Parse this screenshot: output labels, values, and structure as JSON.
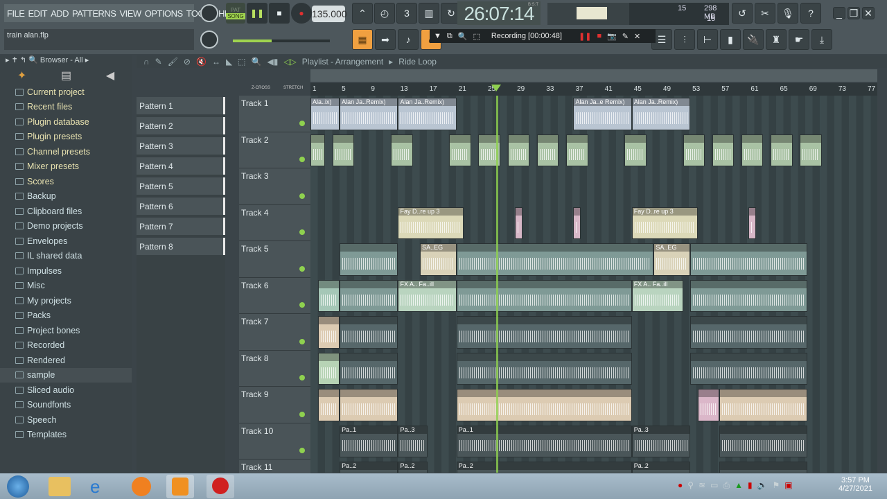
{
  "menu": [
    "FILE",
    "EDIT",
    "ADD",
    "PATTERNS",
    "VIEW",
    "OPTIONS",
    "TOOLS",
    "HELP"
  ],
  "file_name": "train alan.flp",
  "transport": {
    "pat": "PAT",
    "song": "SONG",
    "tempo": "135.000",
    "time": "26:07:14",
    "time_sig": "B:S:T"
  },
  "meters": {
    "cpu": "15",
    "memory": "298 MB",
    "polyphony": "15"
  },
  "recording": {
    "label": "Recording [00:00:48]"
  },
  "browser": {
    "title": "Browser - All",
    "items": [
      "Current project",
      "Recent files",
      "Plugin database",
      "Plugin presets",
      "Channel presets",
      "Mixer presets",
      "Scores",
      "Backup",
      "Clipboard files",
      "Demo projects",
      "Envelopes",
      "IL shared data",
      "Impulses",
      "Misc",
      "My projects",
      "Packs",
      "Project bones",
      "Recorded",
      "Rendered",
      "sample",
      "Sliced audio",
      "Soundfonts",
      "Speech",
      "Templates"
    ],
    "selected": "sample"
  },
  "patterns": [
    "Pattern 1",
    "Pattern 2",
    "Pattern 3",
    "Pattern 4",
    "Pattern 5",
    "Pattern 6",
    "Pattern 7",
    "Pattern 8"
  ],
  "playlist": {
    "title": "Playlist - Arrangement",
    "pattern": "Ride Loop",
    "zcross": "Z-CROSS",
    "stretch": "STRETCH",
    "bars": [
      "1",
      "5",
      "9",
      "13",
      "17",
      "21",
      "25",
      "29",
      "33",
      "37",
      "41",
      "45",
      "49",
      "53",
      "57",
      "61",
      "65",
      "69",
      "73",
      "77"
    ],
    "playhead_bar": 26,
    "tracks": [
      "Track 1",
      "Track 2",
      "Track 3",
      "Track 4",
      "Track 5",
      "Track 6",
      "Track 7",
      "Track 8",
      "Track 9",
      "Track 10",
      "Track 11"
    ],
    "clips": [
      {
        "t": 0,
        "s": 1,
        "l": 4,
        "n": "Ala..ix)",
        "c": "#b9c5d2"
      },
      {
        "t": 0,
        "s": 5,
        "l": 8,
        "n": "Alan Ja..Remix)",
        "c": "#b9c5d2"
      },
      {
        "t": 0,
        "s": 13,
        "l": 8,
        "n": "Alan Ja..Remix)",
        "c": "#b9c5d2"
      },
      {
        "t": 0,
        "s": 37,
        "l": 8,
        "n": "Alan Ja..e Remix)",
        "c": "#b9c5d2"
      },
      {
        "t": 0,
        "s": 45,
        "l": 8,
        "n": "Alan Ja..Remix)",
        "c": "#b9c5d2"
      },
      {
        "t": 1,
        "s": 1,
        "l": 2,
        "n": "",
        "c": "#a9c2a4"
      },
      {
        "t": 1,
        "s": 4,
        "l": 3,
        "n": "",
        "c": "#a9c2a4"
      },
      {
        "t": 1,
        "s": 12,
        "l": 3,
        "n": "",
        "c": "#a9c2a4"
      },
      {
        "t": 1,
        "s": 20,
        "l": 3,
        "n": "",
        "c": "#a9c2a4"
      },
      {
        "t": 1,
        "s": 24,
        "l": 3,
        "n": "",
        "c": "#a9c2a4"
      },
      {
        "t": 1,
        "s": 28,
        "l": 3,
        "n": "",
        "c": "#a9c2a4"
      },
      {
        "t": 1,
        "s": 32,
        "l": 3,
        "n": "",
        "c": "#a9c2a4"
      },
      {
        "t": 1,
        "s": 36,
        "l": 3,
        "n": "",
        "c": "#a9c2a4"
      },
      {
        "t": 1,
        "s": 44,
        "l": 3,
        "n": "",
        "c": "#a9c2a4"
      },
      {
        "t": 1,
        "s": 52,
        "l": 3,
        "n": "",
        "c": "#a9c2a4"
      },
      {
        "t": 1,
        "s": 56,
        "l": 3,
        "n": "",
        "c": "#a9c2a4"
      },
      {
        "t": 1,
        "s": 60,
        "l": 3,
        "n": "",
        "c": "#a9c2a4"
      },
      {
        "t": 1,
        "s": 64,
        "l": 3,
        "n": "",
        "c": "#a9c2a4"
      },
      {
        "t": 1,
        "s": 68,
        "l": 3,
        "n": "",
        "c": "#a9c2a4"
      },
      {
        "t": 3,
        "s": 13,
        "l": 9,
        "n": "Fay D..re up 3",
        "c": "#dcd9b8"
      },
      {
        "t": 3,
        "s": 45,
        "l": 9,
        "n": "Fay D..re up 3",
        "c": "#dcd9b8"
      },
      {
        "t": 3,
        "s": 29,
        "l": 1,
        "n": "",
        "c": "#d7b7c7"
      },
      {
        "t": 3,
        "s": 37,
        "l": 1,
        "n": "",
        "c": "#d7b7c7"
      },
      {
        "t": 3,
        "s": 61,
        "l": 1,
        "n": "",
        "c": "#d7b7c7"
      },
      {
        "t": 4,
        "s": 5,
        "l": 8,
        "n": "",
        "c": "#7f9a96"
      },
      {
        "t": 4,
        "s": 16,
        "l": 5,
        "n": "SA..EG",
        "c": "#d9d2b8"
      },
      {
        "t": 4,
        "s": 21,
        "l": 27,
        "n": "",
        "c": "#7f9a96"
      },
      {
        "t": 4,
        "s": 48,
        "l": 5,
        "n": "SA..EG",
        "c": "#d9d2b8"
      },
      {
        "t": 4,
        "s": 53,
        "l": 16,
        "n": "",
        "c": "#7f9a96"
      },
      {
        "t": 5,
        "s": 2,
        "l": 3,
        "n": "",
        "c": "#a5c7b7"
      },
      {
        "t": 5,
        "s": 5,
        "l": 8,
        "n": "",
        "c": "#7f9a96"
      },
      {
        "t": 5,
        "s": 13,
        "l": 8,
        "n": "FX A.. Fa..ill",
        "c": "#b9d4bf"
      },
      {
        "t": 5,
        "s": 21,
        "l": 24,
        "n": "",
        "c": "#7f9a96"
      },
      {
        "t": 5,
        "s": 45,
        "l": 7,
        "n": "FX A.. Fa..ill",
        "c": "#b9d4bf"
      },
      {
        "t": 5,
        "s": 53,
        "l": 16,
        "n": "",
        "c": "#7f9a96"
      },
      {
        "t": 6,
        "s": 2,
        "l": 3,
        "n": "",
        "c": "#dccbb2"
      },
      {
        "t": 6,
        "s": 5,
        "l": 8,
        "n": "",
        "c": "#56676a"
      },
      {
        "t": 6,
        "s": 21,
        "l": 24,
        "n": "",
        "c": "#56676a"
      },
      {
        "t": 6,
        "s": 53,
        "l": 16,
        "n": "",
        "c": "#56676a"
      },
      {
        "t": 7,
        "s": 2,
        "l": 3,
        "n": "",
        "c": "#b7d3b5"
      },
      {
        "t": 7,
        "s": 5,
        "l": 8,
        "n": "",
        "c": "#56676a"
      },
      {
        "t": 7,
        "s": 21,
        "l": 24,
        "n": "",
        "c": "#56676a"
      },
      {
        "t": 7,
        "s": 53,
        "l": 16,
        "n": "",
        "c": "#56676a"
      },
      {
        "t": 8,
        "s": 2,
        "l": 3,
        "n": "",
        "c": "#dccbb2"
      },
      {
        "t": 8,
        "s": 5,
        "l": 8,
        "n": "",
        "c": "#dccbb2"
      },
      {
        "t": 8,
        "s": 21,
        "l": 24,
        "n": "",
        "c": "#dccbb2"
      },
      {
        "t": 8,
        "s": 54,
        "l": 3,
        "n": "",
        "c": "#dbb7c9"
      },
      {
        "t": 8,
        "s": 57,
        "l": 12,
        "n": "",
        "c": "#dccbb2"
      },
      {
        "t": 9,
        "s": 5,
        "l": 8,
        "n": "Pa..1",
        "c": "#4a5659"
      },
      {
        "t": 9,
        "s": 13,
        "l": 4,
        "n": "Pa..3",
        "c": "#4a5659"
      },
      {
        "t": 9,
        "s": 21,
        "l": 24,
        "n": "Pa..1",
        "c": "#4a5659"
      },
      {
        "t": 9,
        "s": 45,
        "l": 8,
        "n": "Pa..3",
        "c": "#4a5659"
      },
      {
        "t": 9,
        "s": 57,
        "l": 12,
        "n": "",
        "c": "#4a5659"
      },
      {
        "t": 10,
        "s": 5,
        "l": 8,
        "n": "Pa..2",
        "c": "#4a5659"
      },
      {
        "t": 10,
        "s": 13,
        "l": 4,
        "n": "Pa..2",
        "c": "#4a5659"
      },
      {
        "t": 10,
        "s": 21,
        "l": 24,
        "n": "Pa..2",
        "c": "#4a5659"
      },
      {
        "t": 10,
        "s": 45,
        "l": 8,
        "n": "Pa..2",
        "c": "#4a5659"
      },
      {
        "t": 10,
        "s": 57,
        "l": 12,
        "n": "",
        "c": "#4a5659"
      }
    ]
  },
  "clock": {
    "time": "3:57 PM",
    "date": "4/27/2021"
  },
  "colors": {
    "accent": "#f0a040",
    "playhead": "#8fd14f",
    "record": "#e03030"
  }
}
